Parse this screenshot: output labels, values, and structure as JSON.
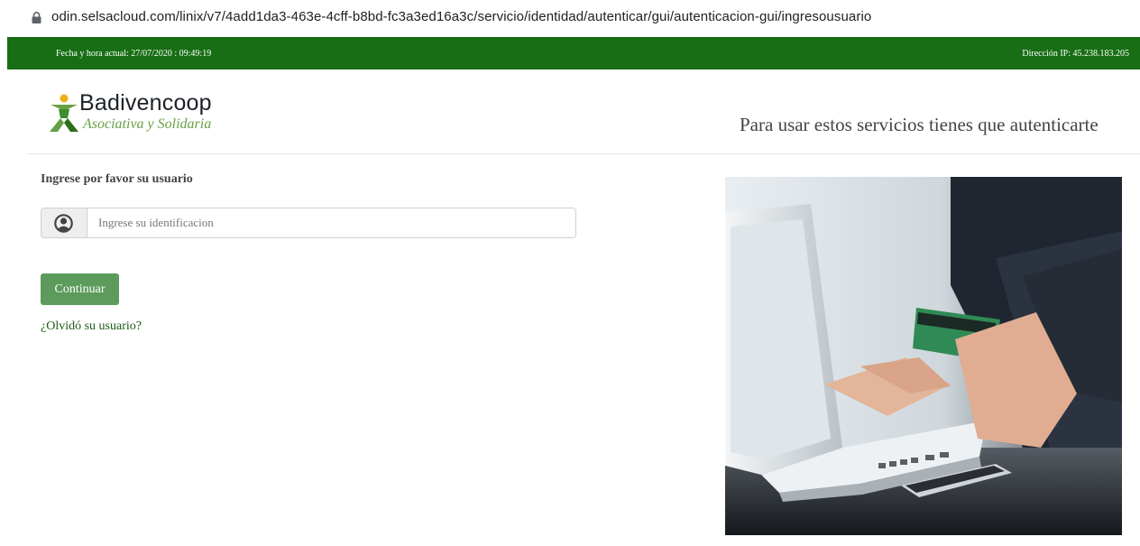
{
  "browser": {
    "url": "odin.selsacloud.com/linix/v7/4add1da3-463e-4cff-b8bd-fc3a3ed16a3c/servicio/identidad/autenticar/gui/autenticacion-gui/ingresousuario",
    "lock_icon": "lock-icon"
  },
  "topbar": {
    "datetime": "Fecha y hora actual: 27/07/2020 : 09:49:19",
    "ip": "Dirección IP: 45.238.183.205",
    "background": "#186e14"
  },
  "logo": {
    "name": "Badivencoop",
    "tagline": "Asociativa y Solidaria",
    "icon": "person-logo-icon"
  },
  "header": {
    "message": "Para usar estos servicios tienes que autenticarte"
  },
  "form": {
    "prompt": "Ingrese por favor su usuario",
    "user_icon": "user-circle-icon",
    "placeholder": "Ingrese su identificacion",
    "value": "",
    "submit_label": "Continuar",
    "forgot_link": "¿Olvidó su usuario?",
    "button_color": "#5c9b5c"
  },
  "image": {
    "icon": "laptop-credit-card-photo"
  }
}
